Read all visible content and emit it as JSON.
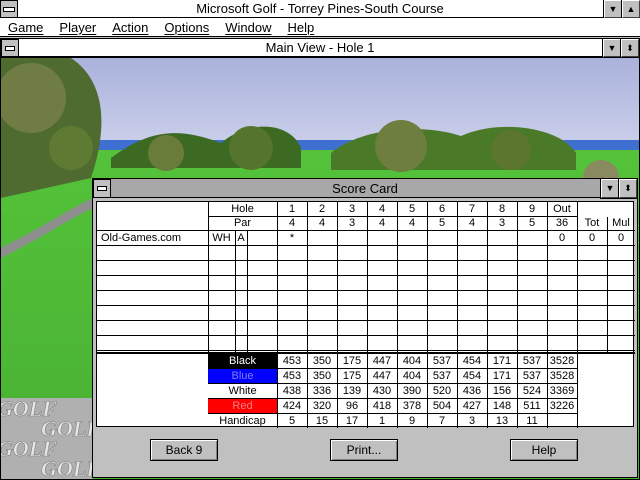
{
  "app": {
    "title": "Microsoft Golf - Torrey Pines-South Course"
  },
  "menu": [
    {
      "label": "Game",
      "accel": "G"
    },
    {
      "label": "Player",
      "accel": "P"
    },
    {
      "label": "Action",
      "accel": "A"
    },
    {
      "label": "Options",
      "accel": "O"
    },
    {
      "label": "Window",
      "accel": "W"
    },
    {
      "label": "Help",
      "accel": "H"
    }
  ],
  "main_view": {
    "title": "Main View - Hole 1"
  },
  "background_logo": "GOLF",
  "scorecard": {
    "title": "Score Card",
    "hole_label": "Hole",
    "par_label": "Par",
    "holes": [
      "1",
      "2",
      "3",
      "4",
      "5",
      "6",
      "7",
      "8",
      "9"
    ],
    "out_label": "Out",
    "tot_label": "Tot",
    "mul_label": "Mul",
    "pars": [
      "4",
      "4",
      "3",
      "4",
      "4",
      "5",
      "4",
      "3",
      "5"
    ],
    "par_out": "36",
    "player": {
      "name": "Old-Games.com",
      "tee": "WH",
      "flag": "A",
      "marker": "*",
      "out": "0",
      "tot": "0",
      "mul": "0"
    },
    "tees": [
      {
        "name": "Black",
        "bg": "#000000",
        "fg": "#ffffff",
        "yards": [
          "453",
          "350",
          "175",
          "447",
          "404",
          "537",
          "454",
          "171",
          "537"
        ],
        "out": "3528"
      },
      {
        "name": "Blue",
        "bg": "#0000ff",
        "fg": "#0000ff",
        "yards": [
          "453",
          "350",
          "175",
          "447",
          "404",
          "537",
          "454",
          "171",
          "537"
        ],
        "out": "3528"
      },
      {
        "name": "White",
        "bg": "#ffffff",
        "fg": "#000000",
        "yards": [
          "438",
          "336",
          "139",
          "430",
          "390",
          "520",
          "436",
          "156",
          "524"
        ],
        "out": "3369"
      },
      {
        "name": "Red",
        "bg": "#ff0000",
        "fg": "#ff0000",
        "yards": [
          "424",
          "320",
          "96",
          "418",
          "378",
          "504",
          "427",
          "148",
          "511"
        ],
        "out": "3226"
      }
    ],
    "handicap_label": "Handicap",
    "handicaps": [
      "5",
      "15",
      "17",
      "1",
      "9",
      "7",
      "3",
      "13",
      "11"
    ],
    "buttons": {
      "back9": "Back 9",
      "print": "Print...",
      "help": "Help"
    }
  }
}
